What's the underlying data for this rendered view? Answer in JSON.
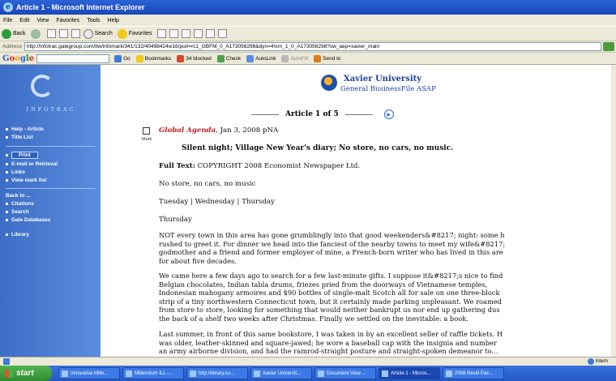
{
  "window": {
    "title": "Article 1 - Microsoft Internet Explorer"
  },
  "menu": [
    "File",
    "Edit",
    "View",
    "Favorites",
    "Tools",
    "Help"
  ],
  "toolbar": {
    "back": "Back",
    "search": "Search",
    "favorites": "Favorites"
  },
  "address": {
    "label": "Address",
    "url": "http://infotrac.galegroup.com/itw/infomark/341/132/40498424w16/purl=rc1_GBFM_0_A173056298&dyn=4!xrn_1_0_A173056298?sw_aep=xavier_main"
  },
  "googlebar": {
    "logo_parts": [
      "G",
      "o",
      "o",
      "g",
      "l",
      "e"
    ],
    "go": "Go",
    "bookmarks": "Bookmarks",
    "blocked": "34 blocked",
    "check": "Check",
    "autolink": "AutoLink",
    "autofill": "AutoFill",
    "sendto": "Send to"
  },
  "sidebar": {
    "logo_text": "INFOTRAC",
    "items_top": [
      "Help - Article",
      "Title List"
    ],
    "print": "Print",
    "items_mid": [
      "E-mail or Retrieval",
      "Links",
      "View mark list"
    ],
    "back_to": "Back to ...",
    "items_back": [
      "Citations",
      "Search",
      "Gale Databases",
      "Library"
    ]
  },
  "header": {
    "university": "Xavier University",
    "database": "General BusinessFile ASAP"
  },
  "article_nav": {
    "label": "Article 1 of 5"
  },
  "article": {
    "mark_label": "Mark",
    "source": "Global Agenda",
    "date": ", Jan 3, 2008 pNA",
    "headline": "Silent night; Village New Year's diary; No store, no cars, no music.",
    "fulltext_label": "Full Text:",
    "copyright": "COPYRIGHT 2008 Economist Newspaper Ltd.",
    "line1": "No store, no cars, no music",
    "line2": "Tuesday | Wednesday | Thursday",
    "line3": "Thursday",
    "p1": [
      "NOT every town in this area has gone grumblingly into that good weekenders&#8217; night: some h",
      "rushed to greet it. For dinner we head into the fanciest of the nearby towns to meet my wife&#8217;",
      "godmother and a friend and former employer of mine, a French-born writer who has lived in this are",
      "for about five decades."
    ],
    "p2": [
      "We came here a few days ago to search for a few last-minute gifts. I suppose it&#8217;s nice to find",
      "Belgian chocolates, Indian tabla drums, friezes pried from the doorways of Vietnamese temples,",
      "Indonesian mahogany armoires and $90 bottles of single-malt Scotch all for sale on one three-block",
      "strip of a tiny northwestern Connecticut town, but it certainly made parking unpleasant. We roamed",
      "from store to store, looking for something that would neither bankrupt us nor end up gathering dus",
      "the back of a shelf two weeks after Christmas. Finally we settled on the inevitable: a book."
    ],
    "p3": [
      "Last summer, in front of this same bookstore, I was taken in by an excellent seller of raffle tickets. H",
      "was older, leather-skinned and square-jawed; he wore a baseball cap with the insignia and number",
      "an army airborne division, and had the ramrod-straight posture and straight-spoken demeanor to..."
    ]
  },
  "status": {
    "zone": "Intern"
  },
  "taskbar": {
    "start": "start",
    "tasks": [
      "Innovative Mille...",
      "Millennium ILL -...",
      "http://library.xu...",
      "Xavier Universit...",
      "Document View ...",
      "Article 1 - Micros...",
      "2008 Revid Pac..."
    ]
  }
}
